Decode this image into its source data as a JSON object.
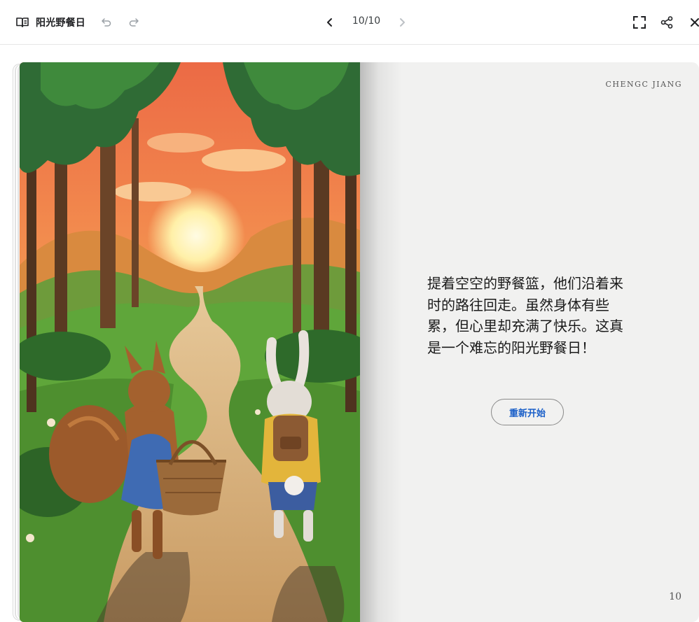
{
  "app": {
    "title": "阳光野餐日",
    "icons": {
      "book": "open-book-icon",
      "undo": "undo-icon",
      "redo": "redo-icon",
      "prev": "chevron-left-icon",
      "next": "chevron-right-icon",
      "fullscreen": "fullscreen-icon",
      "share": "share-icon",
      "close": "close-icon"
    }
  },
  "pager": {
    "current": "10/10"
  },
  "page": {
    "author": "CHENGC JIANG",
    "text": "提着空空的野餐篮，他们沿着来时的路往回走。虽然身体有些累，但心里却充满了快乐。这真是一个难忘的阳光野餐日！",
    "restart_label": "重新开始",
    "page_number": "10"
  },
  "colors": {
    "accent": "#1a5fc8",
    "paper": "#f1f1f0"
  }
}
